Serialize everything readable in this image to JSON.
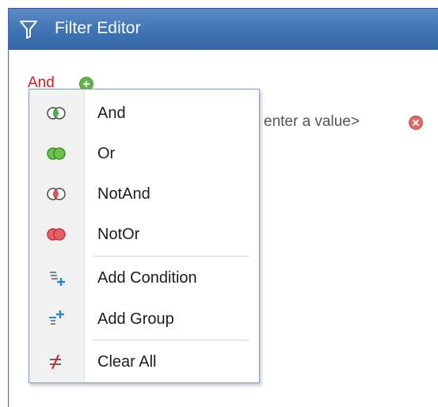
{
  "window": {
    "title": "Filter Editor"
  },
  "filter": {
    "root_operator": "And",
    "value_placeholder": "enter a value>"
  },
  "menu": {
    "items": [
      {
        "label": "And",
        "icon": "and-group-icon"
      },
      {
        "label": "Or",
        "icon": "or-group-icon"
      },
      {
        "label": "NotAnd",
        "icon": "notand-group-icon"
      },
      {
        "label": "NotOr",
        "icon": "notor-group-icon"
      },
      {
        "label": "Add Condition",
        "icon": "add-condition-icon"
      },
      {
        "label": "Add Group",
        "icon": "add-group-icon"
      },
      {
        "label": "Clear All",
        "icon": "clear-all-icon"
      }
    ]
  },
  "colors": {
    "titlebar": "#3f73b4",
    "operator_red": "#e8141e",
    "add_green": "#5eb642",
    "remove_red": "#e36a64"
  }
}
